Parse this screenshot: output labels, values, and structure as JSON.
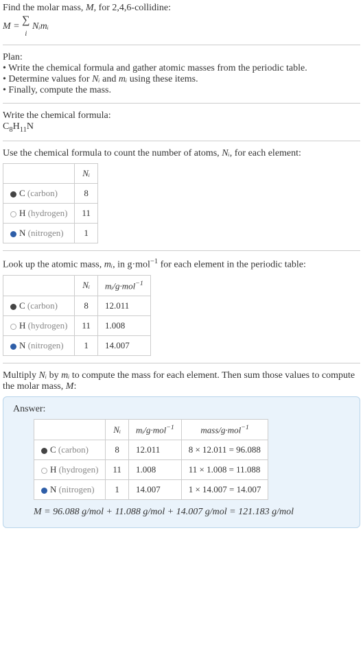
{
  "intro": {
    "line1_pre": "Find the molar mass, ",
    "line1_var": "M",
    "line1_post": ", for 2,4,6-collidine:",
    "formula_lhs": "M",
    "formula_eq": " = ",
    "formula_sum": "∑",
    "formula_idx": "i",
    "formula_rhs": " Nᵢmᵢ"
  },
  "plan": {
    "title": "Plan:",
    "b1": "• Write the chemical formula and gather atomic masses from the periodic table.",
    "b2_pre": "• Determine values for ",
    "b2_n": "Nᵢ",
    "b2_mid": " and ",
    "b2_m": "mᵢ",
    "b2_post": " using these items.",
    "b3": "• Finally, compute the mass."
  },
  "chem": {
    "title": "Write the chemical formula:",
    "c": "C",
    "c_n": "8",
    "h": "H",
    "h_n": "11",
    "n": "N"
  },
  "count": {
    "title_pre": "Use the chemical formula to count the number of atoms, ",
    "title_var": "Nᵢ",
    "title_post": ", for each element:",
    "header_n": "Nᵢ",
    "rows": [
      {
        "sym": "C",
        "name": "(carbon)",
        "n": "8",
        "swatch": "swatch-c"
      },
      {
        "sym": "H",
        "name": "(hydrogen)",
        "n": "11",
        "swatch": "swatch-h"
      },
      {
        "sym": "N",
        "name": "(nitrogen)",
        "n": "1",
        "swatch": "swatch-n"
      }
    ]
  },
  "lookup": {
    "title_pre": "Look up the atomic mass, ",
    "title_var": "mᵢ",
    "title_mid": ", in g·mol",
    "title_exp": "−1",
    "title_post": " for each element in the periodic table:",
    "header_n": "Nᵢ",
    "header_m_pre": "mᵢ/g·mol",
    "header_m_exp": "−1",
    "rows": [
      {
        "sym": "C",
        "name": "(carbon)",
        "n": "8",
        "m": "12.011",
        "swatch": "swatch-c"
      },
      {
        "sym": "H",
        "name": "(hydrogen)",
        "n": "11",
        "m": "1.008",
        "swatch": "swatch-h"
      },
      {
        "sym": "N",
        "name": "(nitrogen)",
        "n": "1",
        "m": "14.007",
        "swatch": "swatch-n"
      }
    ]
  },
  "multiply": {
    "line_pre": "Multiply ",
    "line_n": "Nᵢ",
    "line_mid": " by ",
    "line_m": "mᵢ",
    "line_post1": " to compute the mass for each element. Then sum those values to compute the molar mass, ",
    "line_M": "M",
    "line_post2": ":"
  },
  "answer": {
    "label": "Answer:",
    "header_n": "Nᵢ",
    "header_m_pre": "mᵢ/g·mol",
    "header_m_exp": "−1",
    "header_mass_pre": "mass/g·mol",
    "header_mass_exp": "−1",
    "rows": [
      {
        "sym": "C",
        "name": "(carbon)",
        "n": "8",
        "m": "12.011",
        "mass": "8 × 12.011 = 96.088",
        "swatch": "swatch-c"
      },
      {
        "sym": "H",
        "name": "(hydrogen)",
        "n": "11",
        "m": "1.008",
        "mass": "11 × 1.008 = 11.088",
        "swatch": "swatch-h"
      },
      {
        "sym": "N",
        "name": "(nitrogen)",
        "n": "1",
        "m": "14.007",
        "mass": "1 × 14.007 = 14.007",
        "swatch": "swatch-n"
      }
    ],
    "final_var": "M",
    "final_eq": " = 96.088 g/mol + 11.088 g/mol + 14.007 g/mol = 121.183 g/mol"
  }
}
